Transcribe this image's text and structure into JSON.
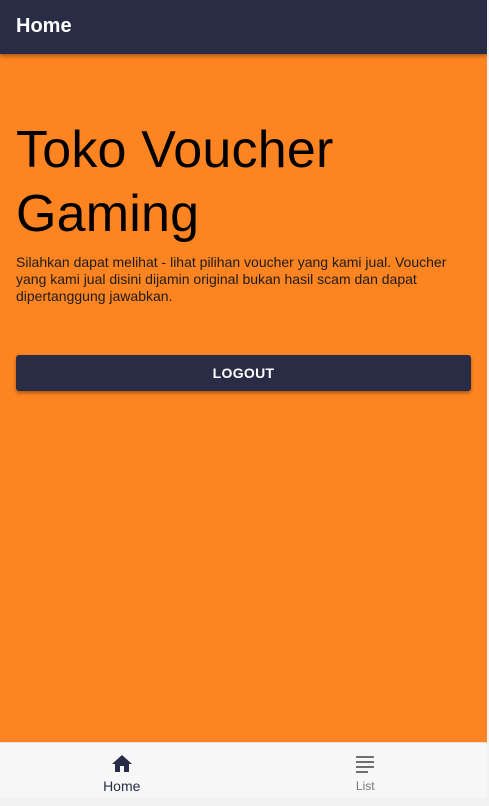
{
  "app_bar": {
    "title": "Home"
  },
  "main": {
    "headline": "Toko Voucher Gaming",
    "description": "Silahkan dapat melihat - lihat pilihan voucher yang kami jual. Voucher yang kami jual disini dijamin original bukan hasil scam dan dapat dipertanggung jawabkan.",
    "logout_label": "LOGOUT"
  },
  "bottom_nav": {
    "items": [
      {
        "label": "Home",
        "icon": "home-icon",
        "active": true
      },
      {
        "label": "List",
        "icon": "list-icon",
        "active": false
      }
    ]
  },
  "colors": {
    "primary": "#282c44",
    "background": "#fd8420",
    "nav_background": "#f7f7f7"
  }
}
